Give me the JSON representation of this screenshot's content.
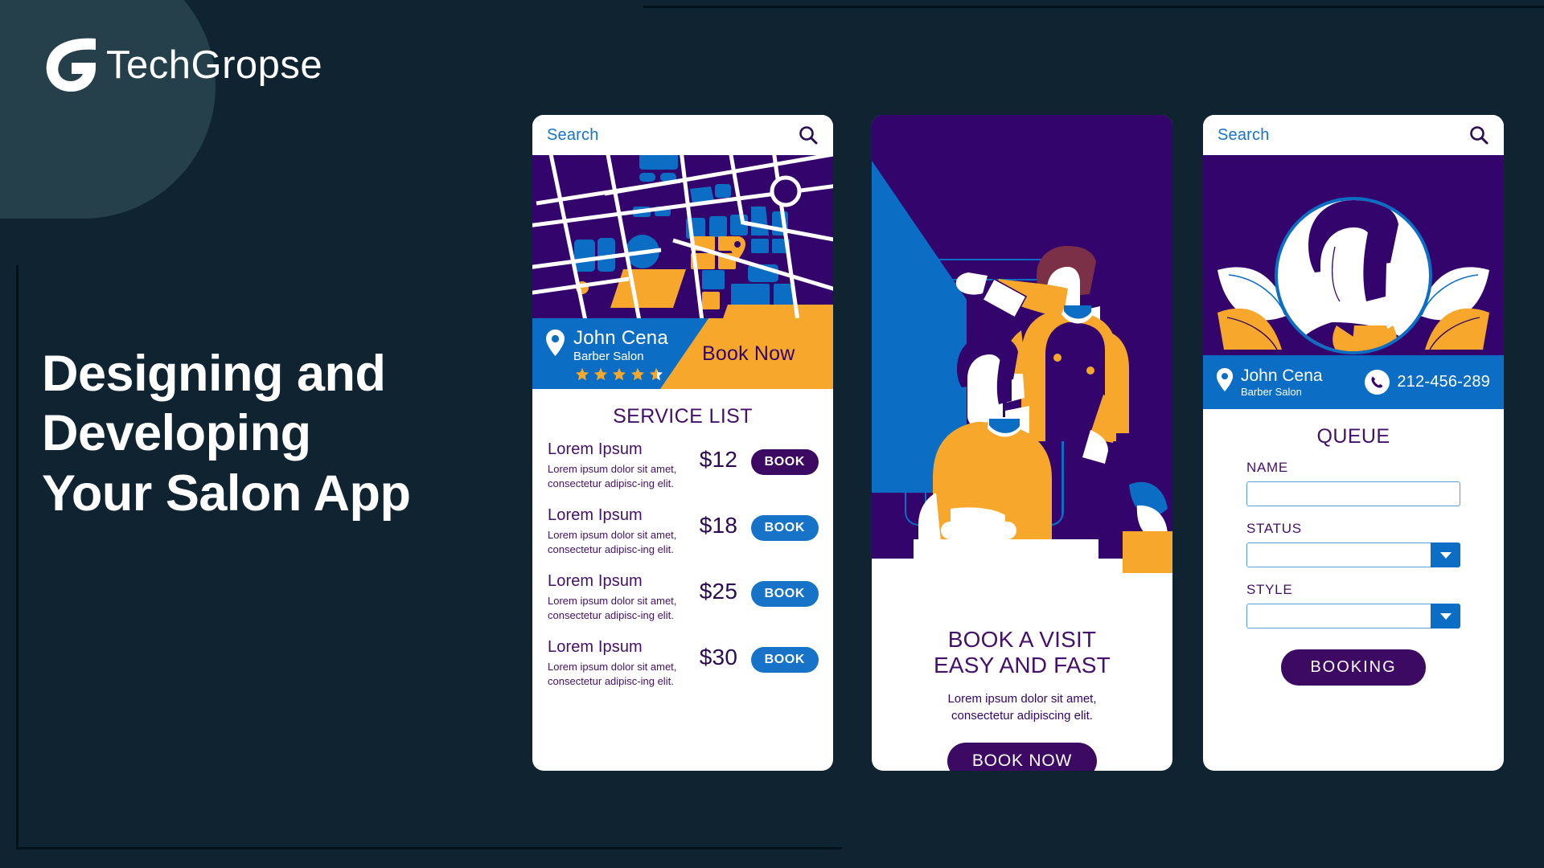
{
  "brand": {
    "logo_icon": "techgropse-g-logo-icon",
    "name": "TechGropse"
  },
  "headline": {
    "line1": "Designing and",
    "line2": "Developing",
    "line3": "Your Salon App"
  },
  "colors": {
    "background": "#0f2430",
    "watermark": "#27424e",
    "purple": "#33046b",
    "purple_deep": "#3d0a63",
    "purple_text": "#44106a",
    "blue": "#0b6ec4",
    "blue_light": "#1673c7",
    "orange": "#f7a72c",
    "white": "#ffffff",
    "input_border": "#5a9fd8"
  },
  "phone1": {
    "search": {
      "placeholder": "Search",
      "icon": "search-icon"
    },
    "map": {
      "icon": "map-pin-icon"
    },
    "salon": {
      "pin_icon": "location-pin-icon",
      "name": "John Cena",
      "subtitle": "Barber Salon",
      "rating": 4.5,
      "stars_total": 5,
      "book_now_label": "Book Now"
    },
    "service_list_title": "SERVICE LIST",
    "services": [
      {
        "name": "Lorem Ipsum",
        "desc": "Lorem ipsum dolor sit amet, consectetur adipisc-ing elit.",
        "price": "$12",
        "book_label": "BOOK",
        "book_color": "#3d0a63"
      },
      {
        "name": "Lorem Ipsum",
        "desc": "Lorem ipsum dolor sit amet, consectetur adipisc-ing elit.",
        "price": "$18",
        "book_label": "BOOK",
        "book_color": "#1673c7"
      },
      {
        "name": "Lorem Ipsum",
        "desc": "Lorem ipsum dolor sit amet, consectetur adipisc-ing elit.",
        "price": "$25",
        "book_label": "BOOK",
        "book_color": "#1673c7"
      },
      {
        "name": "Lorem Ipsum",
        "desc": "Lorem ipsum dolor sit amet, consectetur adipisc-ing elit.",
        "price": "$30",
        "book_label": "BOOK",
        "book_color": "#1673c7"
      }
    ]
  },
  "phone2": {
    "illustration": "barber-cutting-hair-illustration",
    "heading_line1": "BOOK A VISIT",
    "heading_line2": "EASY AND FAST",
    "subtext_line1": "Lorem ipsum dolor sit amet,",
    "subtext_line2": "consectetur adipiscing elit.",
    "cta_label": "BOOK NOW"
  },
  "phone3": {
    "search": {
      "placeholder": "Search",
      "icon": "search-icon"
    },
    "avatar": "barber-avatar-portrait",
    "salon": {
      "pin_icon": "location-pin-icon",
      "name": "John Cena",
      "subtitle": "Barber Salon",
      "phone_icon": "phone-icon",
      "phone_number": "212-456-289"
    },
    "form_title": "QUEUE",
    "fields": [
      {
        "label": "NAME",
        "type": "text",
        "value": ""
      },
      {
        "label": "STATUS",
        "type": "select",
        "value": ""
      },
      {
        "label": "STYLE",
        "type": "select",
        "value": ""
      }
    ],
    "submit_label": "BOOKING"
  }
}
